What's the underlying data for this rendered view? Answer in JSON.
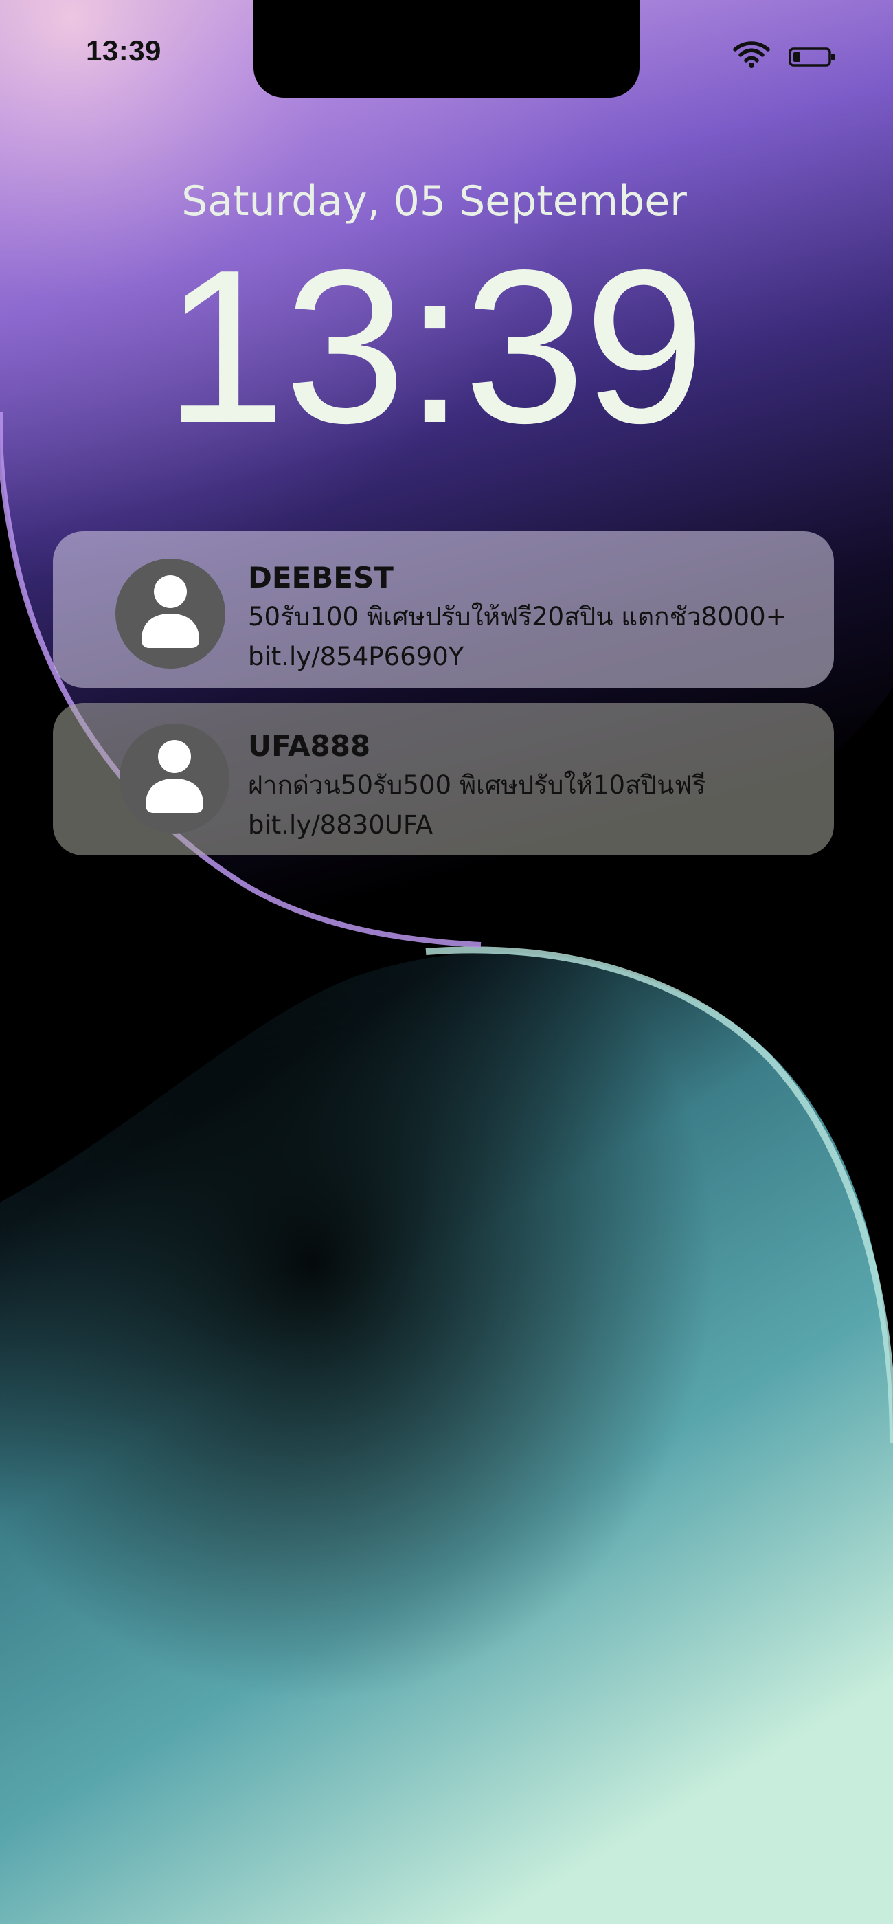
{
  "status_bar": {
    "time": "13:39",
    "wifi_icon": "wifi-icon",
    "battery_icon": "battery-icon"
  },
  "lock_screen": {
    "date": "Saturday, 05 September",
    "time": "13:39"
  },
  "notifications": [
    {
      "avatar_icon": "person-icon",
      "title": "DEEBEST",
      "message": "50รับ100 พิเศษปรับให้ฟรี20สปิน แตกชัว8000+",
      "link": "bit.ly/854P6690Y"
    },
    {
      "avatar_icon": "person-icon",
      "title": "UFA888",
      "message": "ฝากด่วน50รับ500 พิเศษปรับให้10สปินฟรี",
      "link": "bit.ly/8830UFA"
    }
  ],
  "colors": {
    "wallpaper_purple": "#8b6fd6",
    "wallpaper_teal": "#4e9ea8",
    "wallpaper_mint": "#c6eadb",
    "clock_text": "#eef6ea"
  }
}
